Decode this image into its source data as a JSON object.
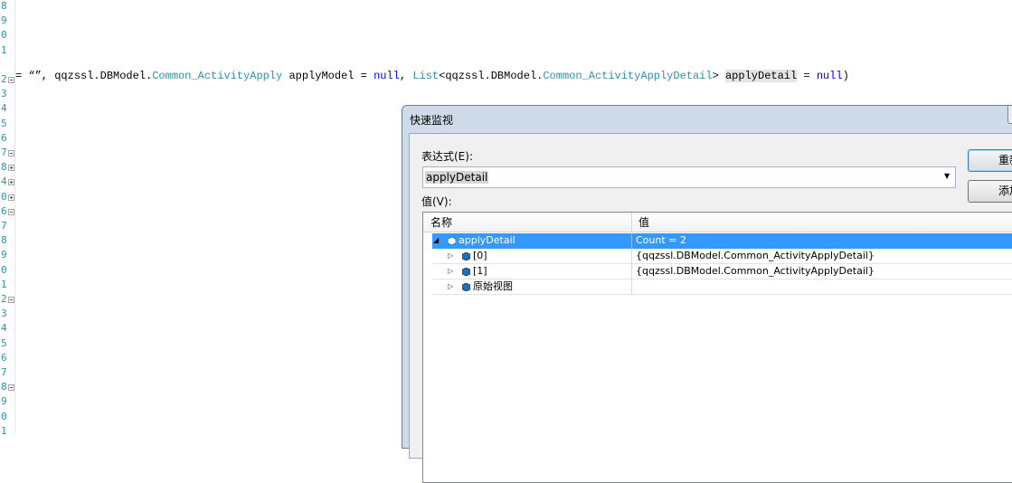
{
  "editor": {
    "line_numbers": [
      "8",
      "9",
      "0",
      "1",
      "",
      "2",
      "3",
      "4",
      "5",
      "6",
      "7",
      "8",
      "4",
      "0",
      "6",
      "7",
      "8",
      "9",
      "0",
      "1",
      "2",
      "3",
      "4",
      "5",
      "6",
      "7",
      "8",
      "9",
      "0",
      "1"
    ],
    "code_tokens": [
      {
        "text": "= “",
        "cls": ""
      },
      {
        "text": "”, qqzssl.DBModel.",
        "cls": ""
      },
      {
        "text": "Common_ActivityApply",
        "cls": "ty"
      },
      {
        "text": " applyModel = ",
        "cls": ""
      },
      {
        "text": "null",
        "cls": "kw"
      },
      {
        "text": ", ",
        "cls": ""
      },
      {
        "text": "List",
        "cls": "ty"
      },
      {
        "text": "<qqzssl.DBModel.",
        "cls": ""
      },
      {
        "text": "Common_ActivityApplyDetail",
        "cls": "ty"
      },
      {
        "text": "> ",
        "cls": ""
      },
      {
        "text": "applyDetail",
        "cls": "hl"
      },
      {
        "text": " = ",
        "cls": ""
      },
      {
        "text": "null",
        "cls": "kw"
      },
      {
        "text": ")",
        "cls": ""
      }
    ]
  },
  "dialog": {
    "title": "快速监视",
    "expression_label": "表达式(E):",
    "expression_value": "applyDetail",
    "value_label": "值(V):",
    "reevaluate_button": "重新计算(R)",
    "add_watch_button": "添加监视(W)",
    "columns": [
      "名称",
      "值"
    ],
    "rows": [
      {
        "name": "applyDetail",
        "value": "Count = 2",
        "level": 0,
        "expanded": true,
        "selected": true
      },
      {
        "name": "[0]",
        "value": "{qqzssl.DBModel.Common_ActivityApplyDetail}",
        "level": 1,
        "expanded": false,
        "selected": false
      },
      {
        "name": "[1]",
        "value": "{qqzssl.DBModel.Common_ActivityApplyDetail}",
        "level": 1,
        "expanded": false,
        "selected": false
      },
      {
        "name": "原始视图",
        "value": "",
        "level": 1,
        "expanded": false,
        "selected": false
      }
    ]
  }
}
